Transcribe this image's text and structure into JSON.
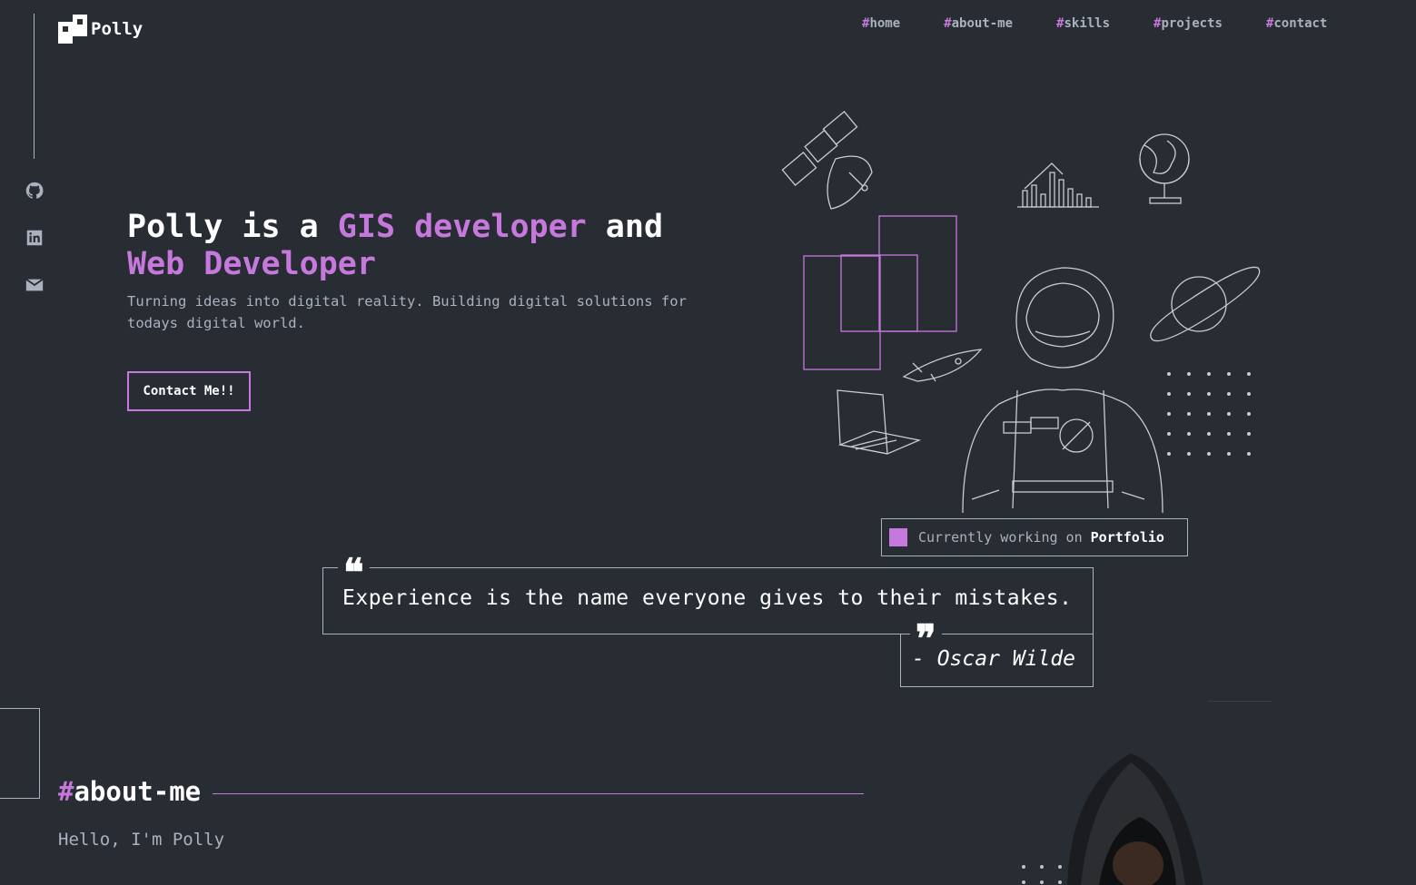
{
  "brand": {
    "name": "Polly",
    "accent": "#c778dd",
    "background": "#282c33",
    "muted": "#abb2bf"
  },
  "nav": [
    {
      "hash": "#",
      "label": "home"
    },
    {
      "hash": "#",
      "label": "about-me"
    },
    {
      "hash": "#",
      "label": "skills"
    },
    {
      "hash": "#",
      "label": "projects"
    },
    {
      "hash": "#",
      "label": "contact"
    }
  ],
  "social": [
    {
      "icon": "github-icon"
    },
    {
      "icon": "linkedin-icon"
    },
    {
      "icon": "email-icon"
    }
  ],
  "hero": {
    "title_1": "Polly is a ",
    "title_accent_1": "GIS developer",
    "title_2": " and ",
    "title_accent_2": "Web Developer",
    "subtitle": "Turning ideas into digital reality. Building digital solutions for todays digital world.",
    "button": "Contact Me!!"
  },
  "status": {
    "prefix": "Currently working on ",
    "project": "Portfolio"
  },
  "quote": {
    "open_mark": "❝",
    "text": "Experience is the name everyone gives to their mistakes.",
    "close_mark": "❞",
    "author": "- Oscar Wilde"
  },
  "about": {
    "hash": "#",
    "title": "about-me",
    "greeting": "Hello, I'm Polly"
  }
}
